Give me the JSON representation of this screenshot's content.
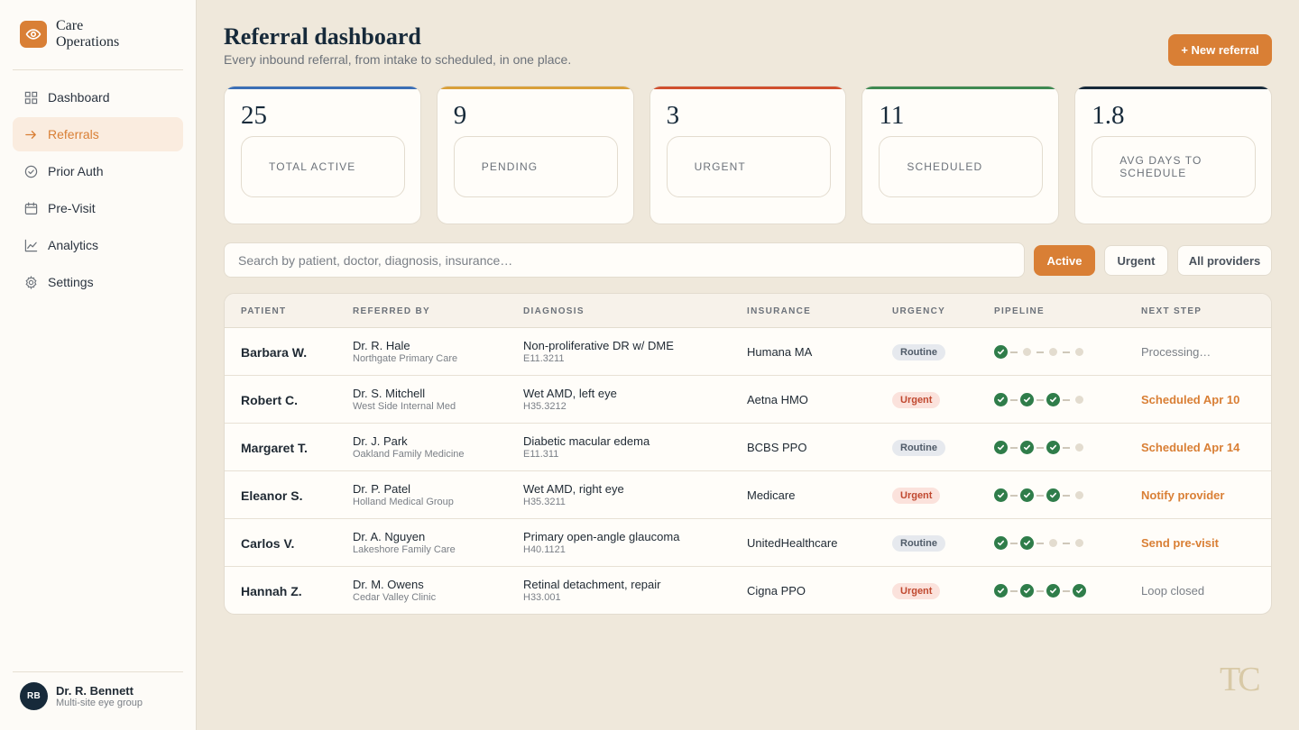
{
  "brand": {
    "name": "Care Operations",
    "icon": "eye-icon"
  },
  "nav": [
    {
      "label": "Dashboard",
      "icon": "grid-icon",
      "active": false
    },
    {
      "label": "Referrals",
      "icon": "arrow-right-icon",
      "active": true
    },
    {
      "label": "Prior Auth",
      "icon": "check-circle-icon",
      "active": false
    },
    {
      "label": "Pre-Visit",
      "icon": "calendar-icon",
      "active": false
    },
    {
      "label": "Analytics",
      "icon": "chart-icon",
      "active": false
    },
    {
      "label": "Settings",
      "icon": "gear-icon",
      "active": false
    }
  ],
  "user": {
    "initials": "RB",
    "name": "Dr. R. Bennett",
    "subtitle": "Multi-site eye group"
  },
  "header": {
    "title": "Referral dashboard",
    "subtitle": "Every inbound referral, from intake to scheduled, in one place.",
    "new_button": "+ New referral"
  },
  "stats": [
    {
      "value": "25",
      "label": "TOTAL ACTIVE",
      "color": "#3b6fb6"
    },
    {
      "value": "9",
      "label": "PENDING",
      "color": "#d9a03a"
    },
    {
      "value": "3",
      "label": "URGENT",
      "color": "#d0502f"
    },
    {
      "value": "11",
      "label": "SCHEDULED",
      "color": "#3f8a52"
    },
    {
      "value": "1.8",
      "label": "AVG DAYS TO SCHEDULE",
      "color": "#172a3a"
    }
  ],
  "search": {
    "placeholder": "Search by patient, doctor, diagnosis, insurance…"
  },
  "filters": [
    {
      "label": "Active",
      "selected": true
    },
    {
      "label": "Urgent",
      "selected": false
    },
    {
      "label": "All providers",
      "selected": false
    }
  ],
  "table": {
    "columns": [
      "PATIENT",
      "REFERRED BY",
      "DIAGNOSIS",
      "INSURANCE",
      "URGENCY",
      "PIPELINE",
      "NEXT STEP"
    ],
    "rows": [
      {
        "patient": "Barbara W.",
        "doctor": "Dr. R. Hale",
        "practice": "Northgate Primary Care",
        "diagnosis": "Non-proliferative DR w/ DME",
        "code": "E11.3211",
        "insurance": "Humana MA",
        "urgency": "Routine",
        "pipeline_done": 1,
        "pipeline_total": 4,
        "next": "Processing…",
        "next_style": "muted"
      },
      {
        "patient": "Robert C.",
        "doctor": "Dr. S. Mitchell",
        "practice": "West Side Internal Med",
        "diagnosis": "Wet AMD, left eye",
        "code": "H35.3212",
        "insurance": "Aetna HMO",
        "urgency": "Urgent",
        "pipeline_done": 3,
        "pipeline_total": 4,
        "next": "Scheduled Apr 10",
        "next_style": "accent"
      },
      {
        "patient": "Margaret T.",
        "doctor": "Dr. J. Park",
        "practice": "Oakland Family Medicine",
        "diagnosis": "Diabetic macular edema",
        "code": "E11.311",
        "insurance": "BCBS PPO",
        "urgency": "Routine",
        "pipeline_done": 3,
        "pipeline_total": 4,
        "next": "Scheduled Apr 14",
        "next_style": "accent"
      },
      {
        "patient": "Eleanor S.",
        "doctor": "Dr. P. Patel",
        "practice": "Holland Medical Group",
        "diagnosis": "Wet AMD, right eye",
        "code": "H35.3211",
        "insurance": "Medicare",
        "urgency": "Urgent",
        "pipeline_done": 3,
        "pipeline_total": 4,
        "next": "Notify provider",
        "next_style": "accent"
      },
      {
        "patient": "Carlos V.",
        "doctor": "Dr. A. Nguyen",
        "practice": "Lakeshore Family Care",
        "diagnosis": "Primary open-angle glaucoma",
        "code": "H40.1121",
        "insurance": "UnitedHealthcare",
        "urgency": "Routine",
        "pipeline_done": 2,
        "pipeline_total": 4,
        "next": "Send pre-visit",
        "next_style": "accent"
      },
      {
        "patient": "Hannah Z.",
        "doctor": "Dr. M. Owens",
        "practice": "Cedar Valley Clinic",
        "diagnosis": "Retinal detachment, repair",
        "code": "H33.001",
        "insurance": "Cigna PPO",
        "urgency": "Urgent",
        "pipeline_done": 4,
        "pipeline_total": 4,
        "next": "Loop closed",
        "next_style": "muted"
      }
    ]
  },
  "watermark": "TC",
  "colors": {
    "accent": "#d97f35",
    "navy": "#172a3a",
    "done": "#2f7d4a"
  }
}
